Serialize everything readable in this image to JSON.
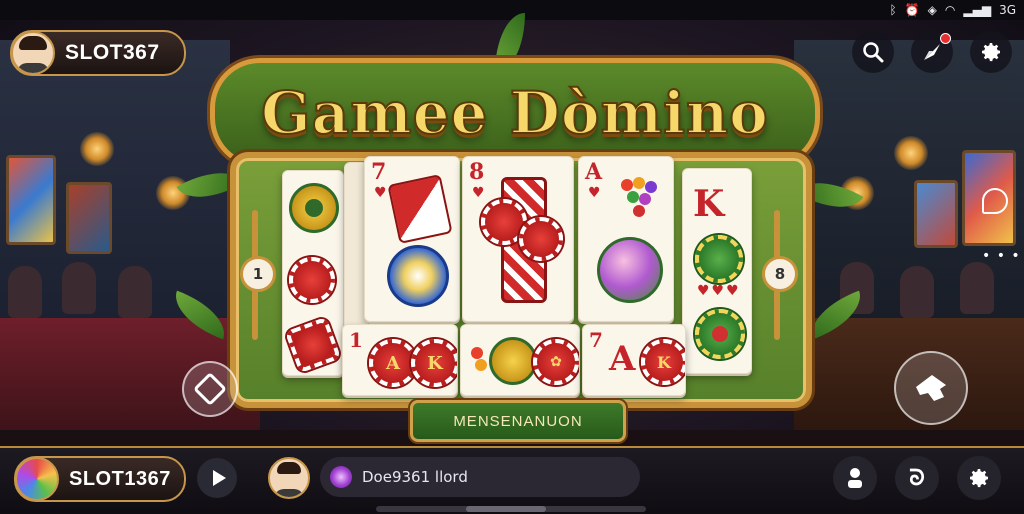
{
  "statusbar": {
    "battery": "3G",
    "icons": [
      "bluetooth-icon",
      "alarm-icon",
      "nfc-icon",
      "wifi-icon",
      "signal-icon"
    ]
  },
  "top": {
    "brand": "SLOT367",
    "actions": [
      "search-icon",
      "rocket-icon",
      "settings-icon"
    ],
    "notification": true
  },
  "game": {
    "title": "Gamee Dòmino",
    "left_marker": "1",
    "right_marker": "8",
    "plaque": "MENSENANUON",
    "cards_top": [
      {
        "rank": "7"
      },
      {
        "rank": "8"
      },
      {
        "rank": "A"
      }
    ],
    "cards_bottom": [
      {
        "rank": "1"
      },
      {
        "rank": ""
      },
      {
        "rank": "7"
      }
    ]
  },
  "bottom": {
    "brand": "SLOT1367",
    "chat_text": "Doe9361 llord"
  },
  "colors": {
    "accent_gold": "#c7964a",
    "felt_green": "#56802a",
    "title_yellow": "#f6d86a",
    "card_red": "#c4242a"
  }
}
